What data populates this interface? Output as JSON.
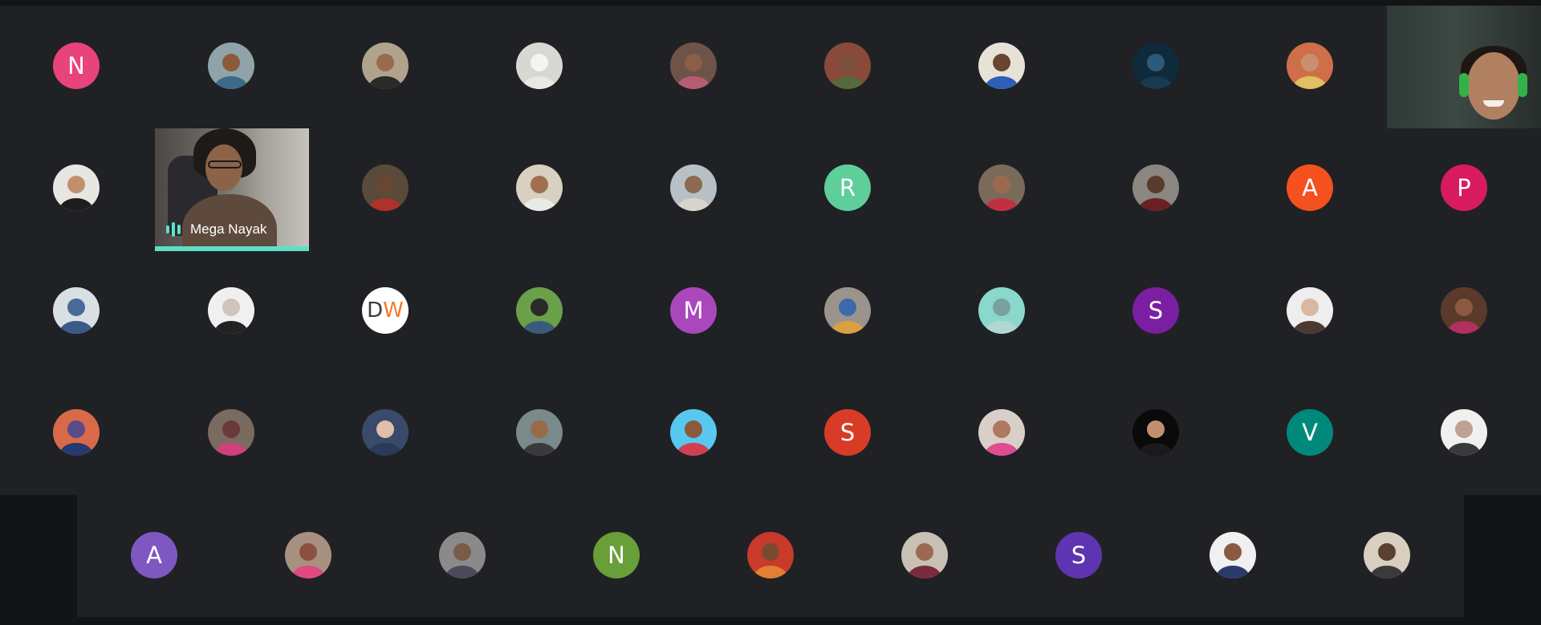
{
  "meeting": {
    "active_speaker": {
      "name": "Mega Nayak",
      "speaking": true
    },
    "self_view": {
      "visible": true
    }
  },
  "rows": [
    [
      {
        "type": "letter",
        "letter": "N",
        "color": "#e8437a"
      },
      {
        "type": "photo",
        "bg": "#8fa3a8",
        "skin": "#8a5a3b",
        "shirt": "#3e6a8a"
      },
      {
        "type": "photo",
        "bg": "#b0a38e",
        "skin": "#9a6a4a",
        "shirt": "#2a2a2a"
      },
      {
        "type": "photo",
        "bg": "#d8d8d2",
        "skin": "#f4f4f0",
        "shirt": "#e8e8e4"
      },
      {
        "type": "photo",
        "bg": "#6e5448",
        "skin": "#8b5e48",
        "shirt": "#b85c74"
      },
      {
        "type": "photo",
        "bg": "#8a4a3a",
        "skin": "#7a5040",
        "shirt": "#556b3a"
      },
      {
        "type": "photo",
        "bg": "#e6e2d8",
        "skin": "#6a4430",
        "shirt": "#2e5fb8"
      },
      {
        "type": "photo",
        "bg": "#0f2a3a",
        "skin": "#2c5a78",
        "shirt": "#1a3a50"
      },
      {
        "type": "photo",
        "bg": "#cf6f4a",
        "skin": "#c89070",
        "shirt": "#e0c060"
      },
      null
    ],
    [
      {
        "type": "photo",
        "bg": "#e8e6e2",
        "skin": "#c0906c",
        "shirt": "#1d1d1d"
      },
      null,
      {
        "type": "photo",
        "bg": "#5a4a3a",
        "skin": "#6a4634",
        "shirt": "#b0302a"
      },
      {
        "type": "photo",
        "bg": "#d8d0c0",
        "skin": "#a07050",
        "shirt": "#eaeae4"
      },
      {
        "type": "photo",
        "bg": "#b8c0c6",
        "skin": "#8a6a50",
        "shirt": "#d8d4cc"
      },
      {
        "type": "letter",
        "letter": "R",
        "color": "#5ecf9a"
      },
      {
        "type": "photo",
        "bg": "#7a6a5a",
        "skin": "#9a6a50",
        "shirt": "#c03040"
      },
      {
        "type": "photo",
        "bg": "#8a8680",
        "skin": "#5a3a2a",
        "shirt": "#6a2020"
      },
      {
        "type": "letter",
        "letter": "A",
        "color": "#f4511e"
      },
      {
        "type": "letter",
        "letter": "P",
        "color": "#d81b60"
      }
    ],
    [
      {
        "type": "photo",
        "bg": "#d8e0e4",
        "skin": "#4a6a9a",
        "shirt": "#3a5a8a"
      },
      {
        "type": "photo",
        "bg": "#f0f0f0",
        "skin": "#d0c4bc",
        "shirt": "#222222"
      },
      {
        "type": "letter-light",
        "letter": "D",
        "letter2": "W",
        "color": "#ffffff"
      },
      {
        "type": "photo",
        "bg": "#6aa048",
        "skin": "#2a2a2a",
        "shirt": "#3a5a7a"
      },
      {
        "type": "letter",
        "letter": "M",
        "color": "#ab47bc"
      },
      {
        "type": "photo",
        "bg": "#9a948c",
        "skin": "#3a6aaa",
        "shirt": "#d8a040"
      },
      {
        "type": "photo",
        "bg": "#8ad8cc",
        "skin": "#7aa0a0",
        "shirt": "#b0d8d0"
      },
      {
        "type": "letter",
        "letter": "S",
        "color": "#7b1fa2"
      },
      {
        "type": "photo",
        "bg": "#eeeeee",
        "skin": "#d8b8a0",
        "shirt": "#4a3a30"
      },
      {
        "type": "photo",
        "bg": "#5a3a2a",
        "skin": "#8a5a40",
        "shirt": "#b03060"
      }
    ],
    [
      {
        "type": "photo",
        "bg": "#d86a4a",
        "skin": "#5a4a8a",
        "shirt": "#243a70"
      },
      {
        "type": "photo",
        "bg": "#7a6a60",
        "skin": "#6a3a3a",
        "shirt": "#d0407a"
      },
      {
        "type": "photo",
        "bg": "#3a4a6a",
        "skin": "#e0c0a8",
        "shirt": "#2a3a5a"
      },
      {
        "type": "photo",
        "bg": "#7a8a8a",
        "skin": "#9a6a48",
        "shirt": "#3a3a3a"
      },
      {
        "type": "photo",
        "bg": "#58c8f0",
        "skin": "#8a5a3a",
        "shirt": "#d04050"
      },
      {
        "type": "letter",
        "letter": "S",
        "color": "#d83c26"
      },
      {
        "type": "photo",
        "bg": "#d8d0c8",
        "skin": "#b07860",
        "shirt": "#e04c90"
      },
      {
        "type": "photo",
        "bg": "#0a0a0a",
        "skin": "#c09070",
        "shirt": "#1a1a1a"
      },
      {
        "type": "letter",
        "letter": "V",
        "color": "#00897b"
      },
      {
        "type": "photo",
        "bg": "#f0f0ee",
        "skin": "#c0a090",
        "shirt": "#3a3a3a"
      }
    ],
    [
      {
        "type": "letter",
        "letter": "A",
        "color": "#7e57c2"
      },
      {
        "type": "photo",
        "bg": "#a89080",
        "skin": "#8a5040",
        "shirt": "#e04880"
      },
      {
        "type": "photo",
        "bg": "#8a8a8a",
        "skin": "#7a5a48",
        "shirt": "#4a4a5a"
      },
      {
        "type": "letter",
        "letter": "N",
        "color": "#689f38"
      },
      {
        "type": "photo",
        "bg": "#c83a2a",
        "skin": "#7a4a30",
        "shirt": "#e08030"
      },
      {
        "type": "photo",
        "bg": "#c8c0b4",
        "skin": "#9a6a50",
        "shirt": "#7a2a3a"
      },
      {
        "type": "letter",
        "letter": "S",
        "color": "#5e35b1"
      },
      {
        "type": "photo",
        "bg": "#f0f0f0",
        "skin": "#8a5a40",
        "shirt": "#2a3a6a"
      },
      {
        "type": "photo",
        "bg": "#d8cfc0",
        "skin": "#5a4030",
        "shirt": "#3a3a3a"
      }
    ]
  ]
}
